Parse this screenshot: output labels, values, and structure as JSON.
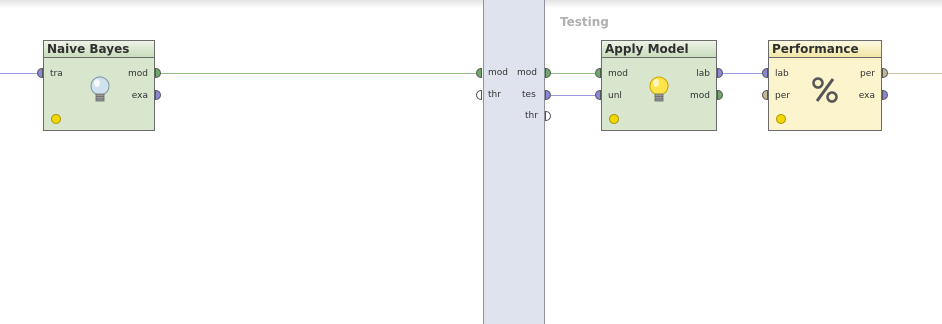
{
  "section": {
    "title": "Testing"
  },
  "operators": {
    "naive_bayes": {
      "title": "Naive Bayes",
      "inputs": [
        "tra"
      ],
      "outputs": [
        "mod",
        "exa"
      ],
      "icon": "lightbulb-off-icon"
    },
    "apply_model": {
      "title": "Apply Model",
      "inputs": [
        "mod",
        "unl"
      ],
      "outputs": [
        "lab",
        "mod"
      ],
      "icon": "lightbulb-on-icon"
    },
    "performance": {
      "title": "Performance",
      "inputs": [
        "lab",
        "per"
      ],
      "outputs": [
        "per",
        "exa"
      ],
      "icon": "percent-icon"
    }
  },
  "divider_ports": {
    "left": [
      "mod",
      "thr"
    ],
    "right": [
      "mod",
      "tes",
      "thr"
    ]
  },
  "colors": {
    "model_port": "#6fa86b",
    "example_port": "#8a86d8",
    "performance_port": "#c2b794",
    "model_wire": "#8fbf84",
    "example_wire": "#9c98e0"
  }
}
